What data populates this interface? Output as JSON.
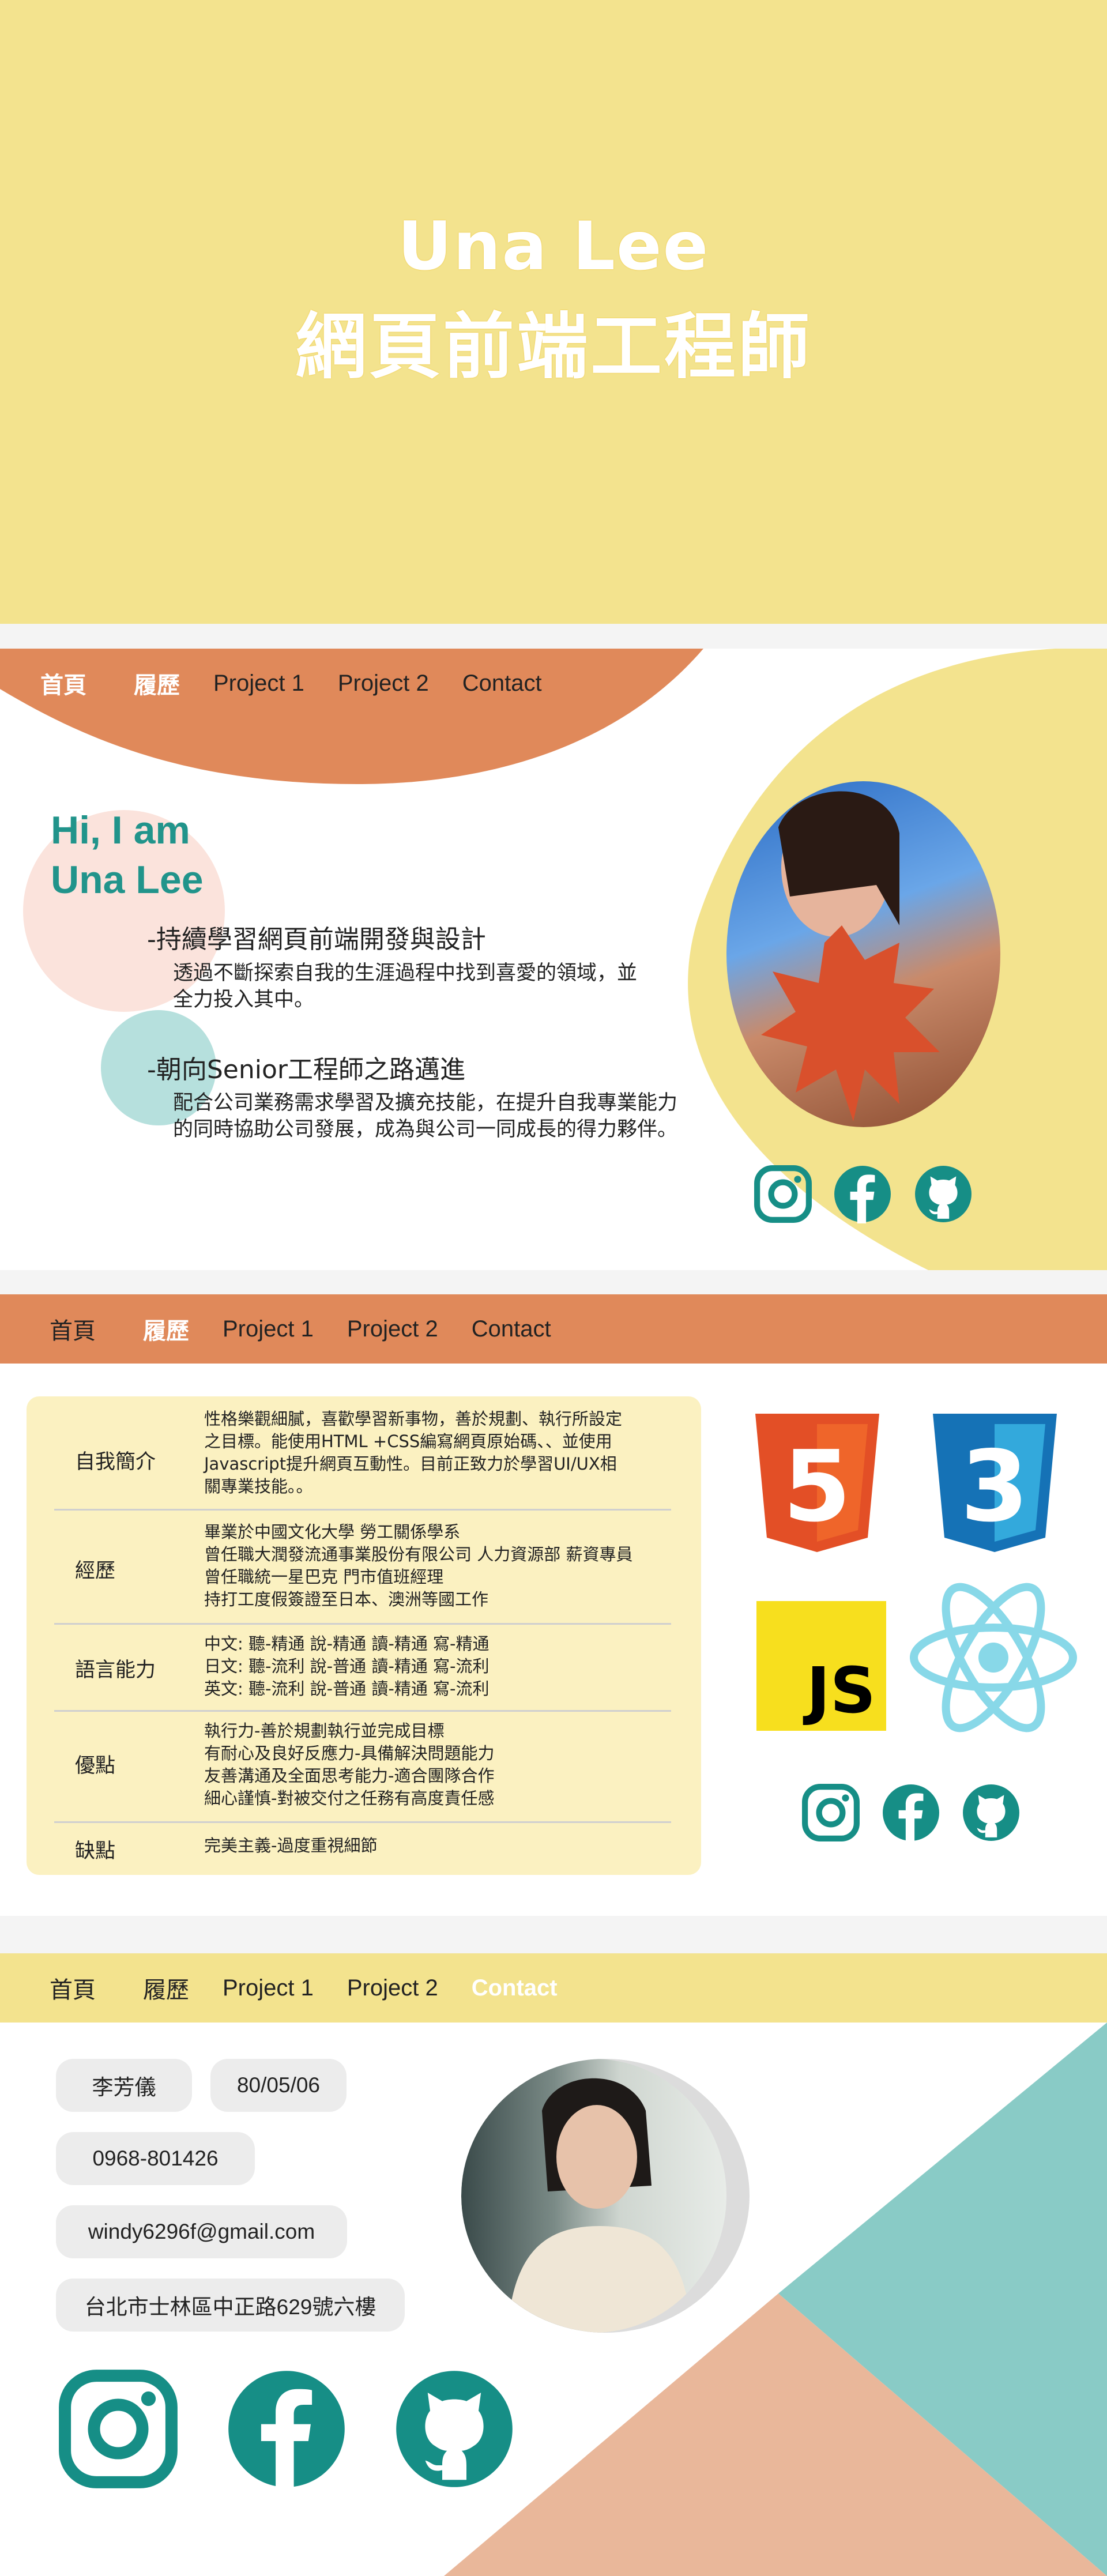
{
  "hero": {
    "name": "Una Lee",
    "role": "網頁前端工程師"
  },
  "nav": {
    "items": [
      "首頁",
      "履歷",
      "Project 1",
      "Project 2",
      "Contact"
    ]
  },
  "about": {
    "greeting_line1": "Hi, I am",
    "greeting_line2": "Una Lee",
    "goals": [
      {
        "title": "-持續學習網頁前端開發與設計",
        "text": "透過不斷探索自我的生涯過程中找到喜愛的領域，並全力投入其中。"
      },
      {
        "title": "-朝向Senior工程師之路邁進",
        "text": "配合公司業務需求學習及擴充技能，在提升自我專業能力的同時協助公司發展，成為與公司一同成長的得力夥伴。"
      }
    ]
  },
  "resume": {
    "rows": [
      {
        "label": "自我簡介",
        "lines": [
          "性格樂觀細膩，喜歡學習新事物，善於規劃、執行所設定",
          "之目標。能使用HTML +CSS編寫網頁原始碼、、並使用",
          "Javascript提升網頁互動性。目前正致力於學習UI/UX相",
          "關專業技能。。"
        ]
      },
      {
        "label": "經歷",
        "lines": [
          "畢業於中國文化大學 勞工關係學系",
          "曾任職大潤發流通事業股份有限公司 人力資源部 薪資專員",
          "曾任職統一星巴克 門市值班經理",
          "持打工度假簽證至日本、澳洲等國工作"
        ]
      },
      {
        "label": "語言能力",
        "lines": [
          "中文: 聽-精通 說-精通 讀-精通 寫-精通",
          "日文: 聽-流利 說-普通 讀-精通 寫-流利",
          "英文: 聽-流利 說-普通 讀-精通 寫-流利"
        ]
      },
      {
        "label": "優點",
        "lines": [
          "執行力-善於規劃執行並完成目標",
          "有耐心及良好反應力-具備解決問題能力",
          "友善溝通及全面思考能力-適合團隊合作",
          "細心謹慎-對被交付之任務有高度責任感"
        ]
      },
      {
        "label": "缺點",
        "lines": [
          "完美主義-過度重視細節"
        ]
      }
    ],
    "skills": {
      "html_digit": "5",
      "css_digit": "3",
      "js_label": "JS"
    }
  },
  "contact": {
    "name": "李芳儀",
    "birthday": "80/05/06",
    "phone": "0968-801426",
    "email": "windy6296f@gmail.com",
    "address": "台北市士林區中正路629號六樓"
  },
  "colors": {
    "yellow": "#f3e38e",
    "orange": "#e0895a",
    "teal": "#21948b",
    "peach": "#e9b79a",
    "mint": "#89cbc6"
  }
}
